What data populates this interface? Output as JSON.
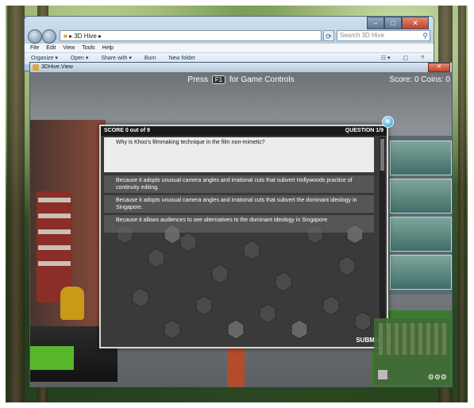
{
  "explorer": {
    "address": "3D Hive",
    "search_placeholder": "Search 3D Hive",
    "menu": [
      "File",
      "Edit",
      "View",
      "Tools",
      "Help"
    ],
    "toolbar": [
      "Organize ▾",
      "Open ▾",
      "Share with ▾",
      "Burn",
      "New folder"
    ]
  },
  "hive": {
    "window_title": "3DHive.View",
    "hint_prefix": "Press",
    "hint_key": "F1",
    "hint_suffix": "for Game Controls",
    "score_coins": "Score: 0 Coins: 0"
  },
  "quiz": {
    "score": "SCORE 0 out of 9",
    "question_number": "QUESTION 1/9",
    "question": "Why is Khoo's filmmaking technique in the film non-mimetic?",
    "answers": [
      "Because it adopts unusual camera angles and irrational cuts that subvert Hollywoods practice of continuity editing.",
      "Because it adopts unusual camera angles and irrational cuts that subvert the dominant ideology in Singapore.",
      "Because it allows audiences to see alternatives to the dominant ideology in Singapore."
    ],
    "submit": "SUBMIT",
    "close_glyph": "✕"
  }
}
